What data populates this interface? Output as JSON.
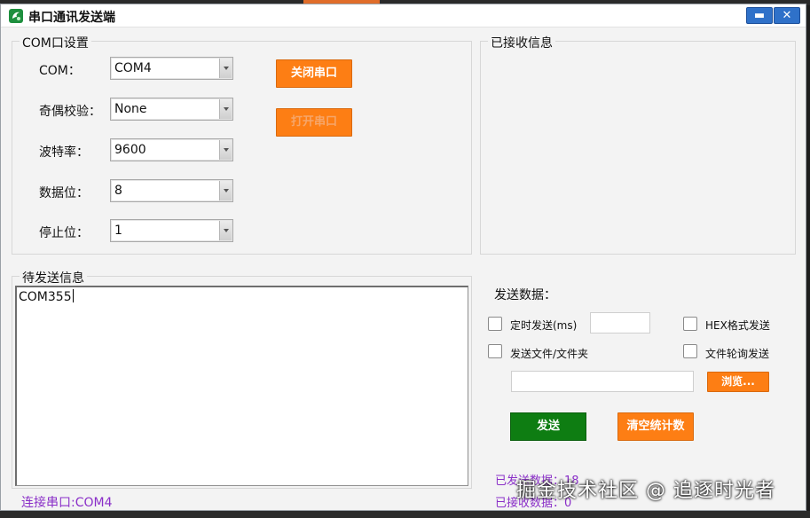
{
  "window": {
    "title": "串口通讯发送端",
    "minimize_label": "▬",
    "close_label": "✕"
  },
  "com_settings": {
    "legend": "COM口设置",
    "com_label": "COM：",
    "com_value": "COM4",
    "parity_label": "奇偶校验：",
    "parity_value": "None",
    "baud_label": "波特率：",
    "baud_value": "9600",
    "databits_label": "数据位：",
    "databits_value": "8",
    "stopbits_label": "停止位：",
    "stopbits_value": "1",
    "close_port_button": "关闭串口",
    "open_port_button": "打开串口"
  },
  "received": {
    "legend": "已接收信息"
  },
  "pending": {
    "legend": "待发送信息",
    "text": "COM355"
  },
  "send_panel": {
    "title": "发送数据：",
    "timed_send_label": "定时发送(ms)",
    "timed_send_value": "",
    "hex_send_label": "HEX格式发送",
    "send_file_label": "发送文件/文件夹",
    "file_poll_label": "文件轮询发送",
    "file_path_value": "",
    "browse_button": "浏览...",
    "send_button": "发送",
    "clear_stats_button": "清空统计数"
  },
  "stats": {
    "sent_label": "已发送数据：",
    "sent_value": "18",
    "received_label": "已接收数据：",
    "received_value": "0"
  },
  "status_bar": {
    "connection": "连接串口:COM4"
  },
  "watermark": "掘金技术社区 @ 追逐时光者",
  "colors": {
    "accent_orange": "#fd7e14",
    "send_green": "#0e7d12",
    "stats_purple": "#8a2fc8",
    "titlebar_button_blue": "#2f71c9"
  }
}
